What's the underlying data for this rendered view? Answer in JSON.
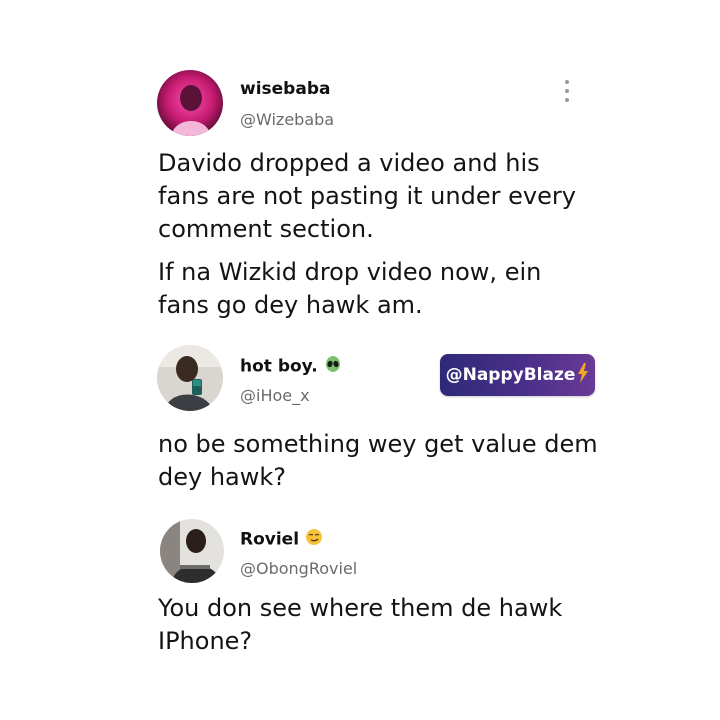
{
  "posts": [
    {
      "name": "wisebaba",
      "handle": "@Wizebaba",
      "paragraphs": [
        "Davido dropped a video and his fans are not pasting it under every comment section.",
        "If na Wizkid drop video now, ein fans go dey hawk am."
      ],
      "avatar_icon": "avatar-photo-pink",
      "has_menu": true
    },
    {
      "name": "hot boy.",
      "name_emoji": "alien-emoji",
      "handle": "@iHoe_x",
      "paragraphs": [
        "no be something wey get value dem dey hawk?"
      ],
      "avatar_icon": "avatar-photo-mirror-selfie"
    },
    {
      "name": "Roviel",
      "name_emoji": "smirking-face-emoji",
      "handle": "@ObongRoviel",
      "paragraphs": [
        "You don see where them de hawk IPhone?"
      ],
      "avatar_icon": "avatar-photo-group"
    }
  ],
  "watermark": {
    "label": "@NappyBlaze",
    "icon": "lightning-bolt-icon"
  },
  "colors": {
    "handle": "#6b6b6b",
    "watermark_gradient_start": "#2e2a78",
    "watermark_gradient_end": "#6a3a96",
    "bolt": "#f5a623"
  }
}
